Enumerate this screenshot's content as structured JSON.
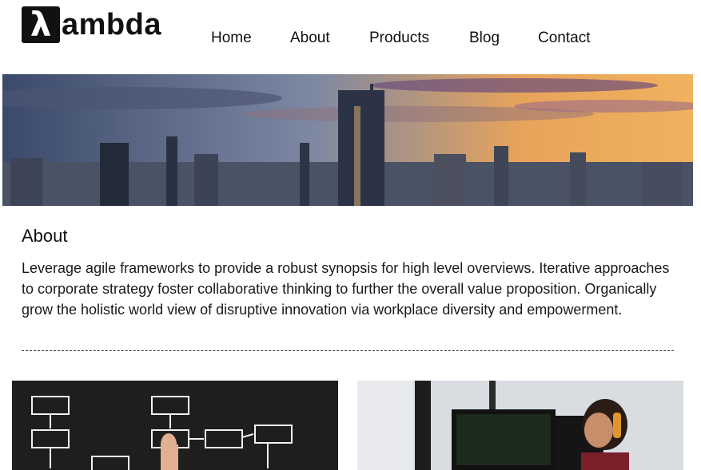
{
  "brand": {
    "symbol": "λ",
    "name": "ambda"
  },
  "nav": {
    "items": [
      {
        "label": "Home"
      },
      {
        "label": "About"
      },
      {
        "label": "Products"
      },
      {
        "label": "Blog"
      },
      {
        "label": "Contact"
      }
    ]
  },
  "about": {
    "title": "About",
    "body": "Leverage agile frameworks to provide a robust synopsis for high level overviews. Iterative approaches to corporate strategy foster collaborative thinking to further the overall value proposition. Organically grow the holistic world view of disruptive innovation via workplace diversity and empowerment."
  }
}
